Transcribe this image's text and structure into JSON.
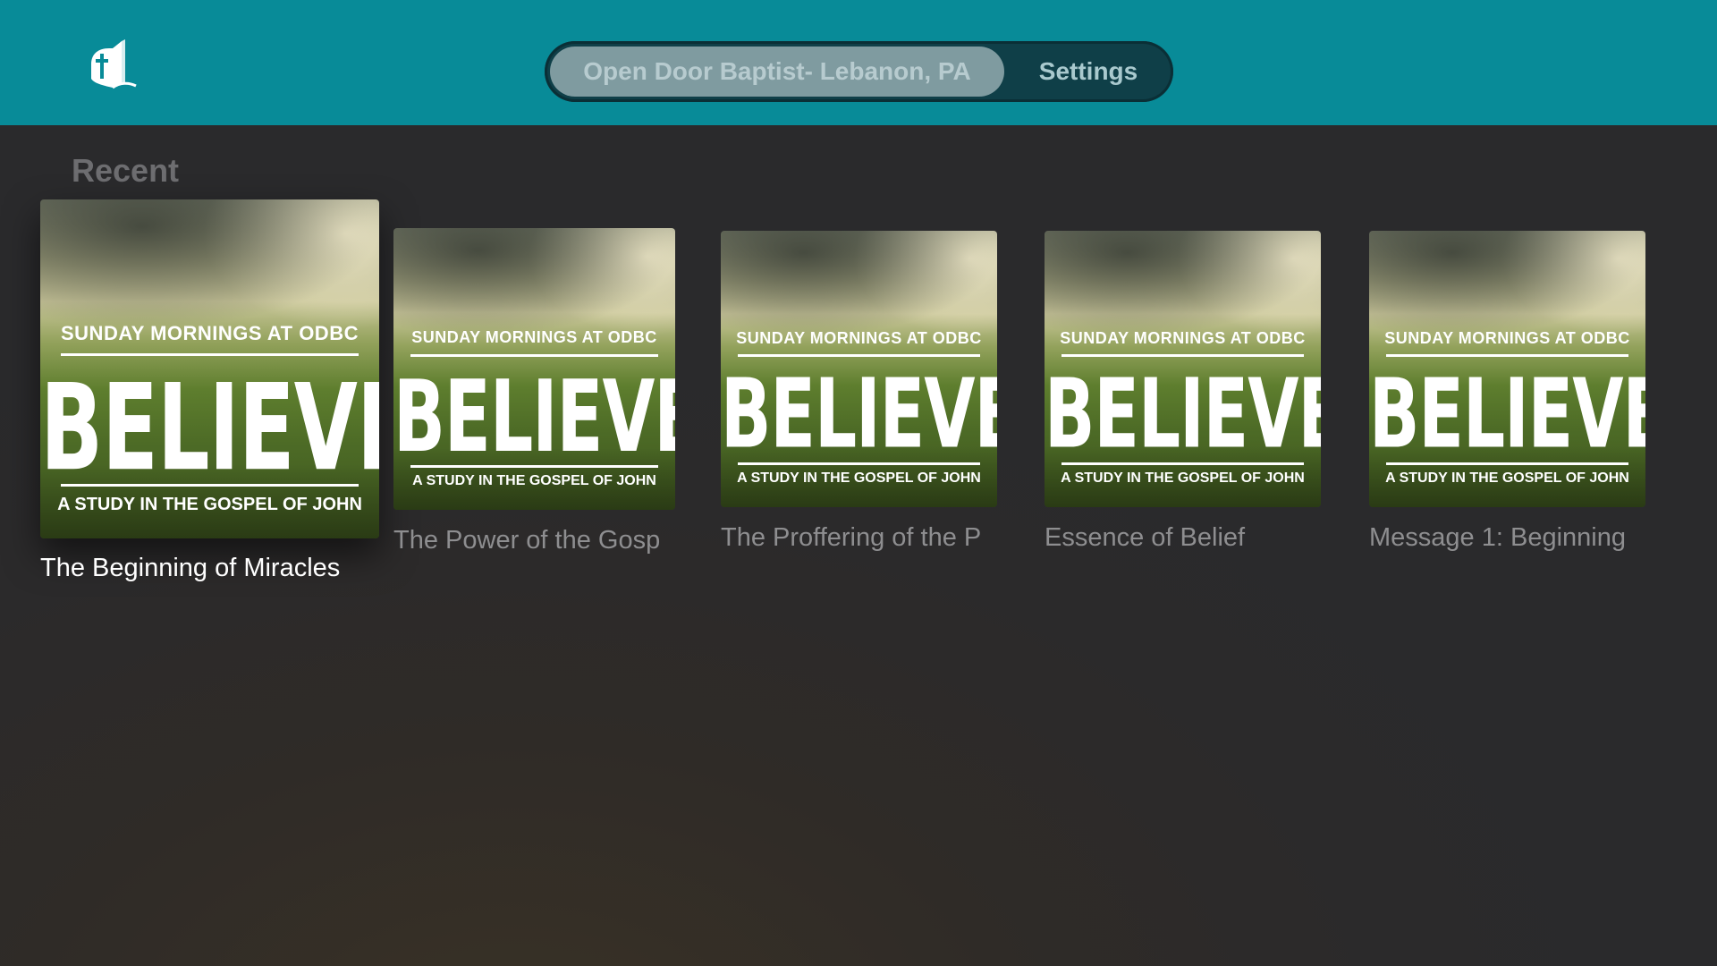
{
  "header": {
    "logo_icon": "church-bible-cross-icon",
    "background_color": "#088b98",
    "tabs": [
      {
        "label": "Open Door Baptist- Lebanon, PA",
        "selected": true
      },
      {
        "label": "Settings",
        "selected": false
      }
    ]
  },
  "recent": {
    "title": "Recent",
    "items": [
      {
        "title": "The Beginning of Miracles",
        "art_top": "SUNDAY MORNINGS AT ODBC",
        "art_main": "BELIEVE",
        "art_bottom": "A STUDY IN THE GOSPEL OF JOHN",
        "focused": true
      },
      {
        "title": "The Power of the Gosp",
        "art_top": "SUNDAY MORNINGS AT ODBC",
        "art_main": "BELIEVE",
        "art_bottom": "A STUDY IN THE GOSPEL OF JOHN",
        "focused": false
      },
      {
        "title": "The Proffering of the P",
        "art_top": "SUNDAY MORNINGS AT ODBC",
        "art_main": "BELIEVE",
        "art_bottom": "A STUDY IN THE GOSPEL OF JOHN",
        "focused": false
      },
      {
        "title": "Essence of Belief",
        "art_top": "SUNDAY MORNINGS AT ODBC",
        "art_main": "BELIEVE",
        "art_bottom": "A STUDY IN THE GOSPEL OF JOHN",
        "focused": false
      },
      {
        "title": "Message 1: Beginning",
        "art_top": "SUNDAY MORNINGS AT ODBC",
        "art_main": "BELIEVE",
        "art_bottom": "A STUDY IN THE GOSPEL OF JOHN",
        "focused": false
      }
    ]
  }
}
